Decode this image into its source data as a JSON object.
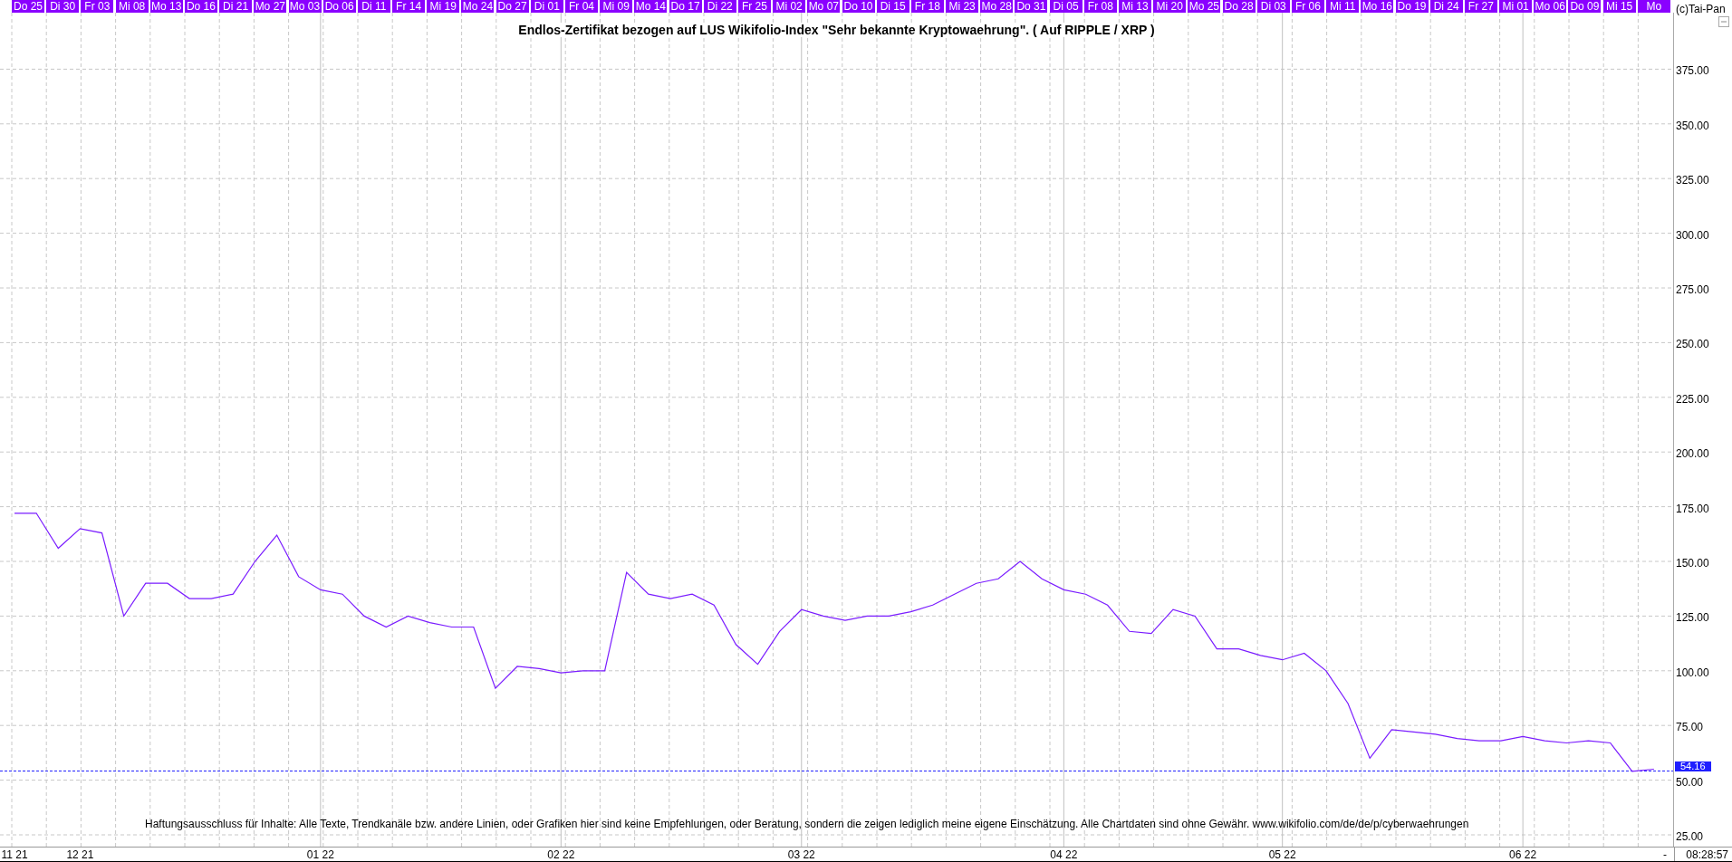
{
  "date_strip": [
    "Do 25",
    "Di 30",
    "Fr 03",
    "Mi 08",
    "Mo 13",
    "Do 16",
    "Di 21",
    "Mo 27",
    "Mo 03",
    "Do 06",
    "Di 11",
    "Fr 14",
    "Mi 19",
    "Mo 24",
    "Do 27",
    "Di 01",
    "Fr 04",
    "Mi 09",
    "Mo 14",
    "Do 17",
    "Di 22",
    "Fr 25",
    "Mi 02",
    "Mo 07",
    "Do 10",
    "Di 15",
    "Fr 18",
    "Mi 23",
    "Mo 28",
    "Do 31",
    "Di 05",
    "Fr 08",
    "Mi 13",
    "Mi 20",
    "Mo 25",
    "Do 28",
    "Di 03",
    "Fr 06",
    "Mi 11",
    "Mo 16",
    "Do 19",
    "Di 24",
    "Fr 27",
    "Mi 01",
    "Mo 06",
    "Do 09",
    "Mi 15",
    "Mo"
  ],
  "copyright": "(c)Tai-Pan",
  "chart": {
    "disclaimer": "Haftungsausschluss für Inhalte: Alle Texte, Trendkanäle bzw. andere Linien, oder Grafiken hier sind keine Empfehlungen, oder Beratung, sondern die zeigen lediglich meine eigene Einschätzung. Alle Chartdaten sind ohne Gewähr.  www.wikifolio.com/de/de/p/cyberwaehrungen",
    "last_price": "54.16",
    "chart_data": {
      "type": "line",
      "grid": true,
      "ref_lines": [
        {
          "axis": "y",
          "value": 54.16,
          "color": "#2020ff"
        }
      ],
      "title": "Endlos-Zertifikat bezogen auf LUS Wikifolio-Index \"Sehr bekannte Kryptowaehrung\". ( Auf RIPPLE / XRP )",
      "ylim": [
        25,
        400
      ],
      "yticks": [
        {
          "value": 25,
          "label": "25.00"
        },
        {
          "value": 50,
          "label": "50.00"
        },
        {
          "value": 75,
          "label": "75.00"
        },
        {
          "value": 100,
          "label": "100.00"
        },
        {
          "value": 125,
          "label": "125.00"
        },
        {
          "value": 150,
          "label": "150.00"
        },
        {
          "value": 175,
          "label": "175.00"
        },
        {
          "value": 200,
          "label": "200.00"
        },
        {
          "value": 225,
          "label": "225.00"
        },
        {
          "value": 250,
          "label": "250.00"
        },
        {
          "value": 275,
          "label": "275.00"
        },
        {
          "value": 300,
          "label": "300.00"
        },
        {
          "value": 325,
          "label": "325.00"
        },
        {
          "value": 350,
          "label": "350.00"
        },
        {
          "value": 375,
          "label": "375.00"
        }
      ],
      "categories": [
        "11 21",
        null,
        null,
        "12 21",
        null,
        null,
        null,
        null,
        null,
        null,
        null,
        null,
        null,
        null,
        "01 22",
        null,
        null,
        null,
        null,
        null,
        null,
        null,
        null,
        null,
        null,
        "02 22",
        null,
        null,
        null,
        null,
        null,
        null,
        null,
        null,
        null,
        null,
        "03 22",
        null,
        null,
        null,
        null,
        null,
        null,
        null,
        null,
        null,
        null,
        null,
        "04 22",
        null,
        null,
        null,
        null,
        null,
        null,
        null,
        null,
        null,
        "05 22",
        null,
        null,
        null,
        null,
        null,
        null,
        null,
        null,
        null,
        null,
        "06 22",
        null,
        null,
        null,
        null,
        null,
        null
      ],
      "series": [
        {
          "color": "#7a1cff",
          "values": [
            172,
            172,
            156,
            165,
            163,
            125,
            140,
            140,
            133,
            133,
            135,
            150,
            162,
            143,
            137,
            135,
            125,
            120,
            125,
            122,
            120,
            120,
            92,
            102,
            101,
            99,
            100,
            100,
            145,
            135,
            133,
            135,
            130,
            112,
            103,
            118,
            128,
            125,
            123,
            125,
            125,
            127,
            130,
            135,
            140,
            142,
            150,
            142,
            137,
            135,
            130,
            118,
            117,
            128,
            125,
            110,
            110,
            107,
            105,
            108,
            100,
            85,
            60,
            73,
            72,
            71,
            69,
            68,
            68,
            70,
            68,
            67,
            68,
            67,
            54,
            55
          ]
        }
      ]
    }
  },
  "x_axis": {
    "marker": "-",
    "time": "08:28:57"
  }
}
